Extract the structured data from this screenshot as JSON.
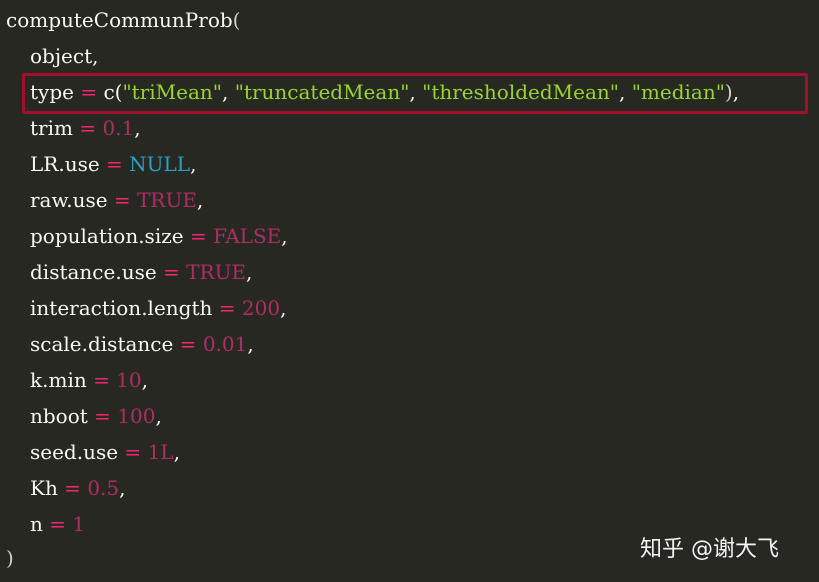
{
  "code": {
    "function_name": "computeCommunProb",
    "open_paren": "(",
    "close_paren": ")",
    "lines": [
      {
        "param": "object",
        "tail": ","
      },
      {
        "param": "type",
        "eq": " = ",
        "call": "c(",
        "strings": [
          "\"triMean\"",
          "\"truncatedMean\"",
          "\"thresholdedMean\"",
          "\"median\""
        ],
        "sep": ", ",
        "call_close": ")",
        "tail": ","
      },
      {
        "param": "trim",
        "eq": " = ",
        "value": "0.1",
        "kind": "num",
        "tail": ","
      },
      {
        "param": "LR.use",
        "eq": " = ",
        "value": "NULL",
        "kind": "null",
        "tail": ","
      },
      {
        "param": "raw.use",
        "eq": " = ",
        "value": "TRUE",
        "kind": "num",
        "tail": ","
      },
      {
        "param": "population.size",
        "eq": " = ",
        "value": "FALSE",
        "kind": "num",
        "tail": ","
      },
      {
        "param": "distance.use",
        "eq": " = ",
        "value": "TRUE",
        "kind": "num",
        "tail": ","
      },
      {
        "param": "interaction.length",
        "eq": " = ",
        "value": "200",
        "kind": "num",
        "tail": ","
      },
      {
        "param": "scale.distance",
        "eq": " = ",
        "value": "0.01",
        "kind": "num",
        "tail": ","
      },
      {
        "param": "k.min",
        "eq": " = ",
        "value": "10",
        "kind": "num",
        "tail": ","
      },
      {
        "param": "nboot",
        "eq": " = ",
        "value": "100",
        "kind": "num",
        "tail": ","
      },
      {
        "param": "seed.use",
        "eq": " = ",
        "value": "1L",
        "kind": "num",
        "tail": ","
      },
      {
        "param": "Kh",
        "eq": " = ",
        "value": "0.5",
        "kind": "num",
        "tail": ","
      },
      {
        "param": "n",
        "eq": " = ",
        "value": "1",
        "kind": "num",
        "tail": ""
      }
    ]
  },
  "highlight": {
    "target_line": 1,
    "color": "#a0102a"
  },
  "watermark": {
    "text": "知乎 @谢大飞"
  },
  "colors": {
    "background": "#272822",
    "text": "#f8f8f2",
    "operator": "#f92672",
    "number": "#ae2d64",
    "null": "#2b9fc8",
    "string": "#9ad52e"
  }
}
